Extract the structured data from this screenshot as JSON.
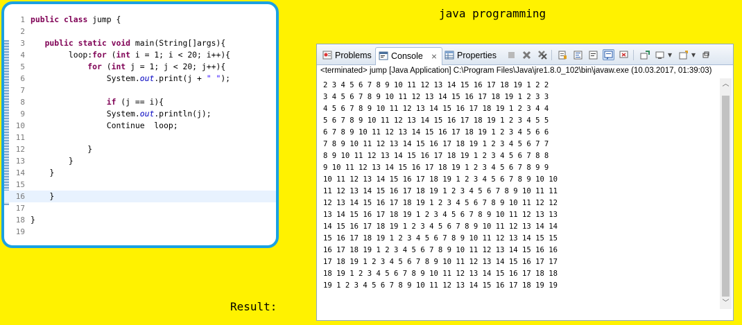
{
  "page": {
    "heading": "java programming",
    "result_label": "Result:"
  },
  "editor": {
    "lines": [
      {
        "n": "1",
        "code": "public class jump {"
      },
      {
        "n": "2",
        "code": ""
      },
      {
        "n": "3",
        "code": "   public static void main(String[]args){"
      },
      {
        "n": "4",
        "code": "        loop:for (int i = 1; i < 20; i++){"
      },
      {
        "n": "5",
        "code": "            for (int j = 1; j < 20; j++){"
      },
      {
        "n": "6",
        "code": "                System.out.print(j + \" \");"
      },
      {
        "n": "7",
        "code": ""
      },
      {
        "n": "8",
        "code": "                if (j == i){"
      },
      {
        "n": "9",
        "code": "                System.out.println(j);"
      },
      {
        "n": "10",
        "code": "                Continue  loop;"
      },
      {
        "n": "11",
        "code": ""
      },
      {
        "n": "12",
        "code": "            }"
      },
      {
        "n": "13",
        "code": "        }"
      },
      {
        "n": "14",
        "code": "    }"
      },
      {
        "n": "15",
        "code": ""
      },
      {
        "n": "16",
        "code": "    }"
      },
      {
        "n": "17",
        "code": ""
      },
      {
        "n": "18",
        "code": "}"
      },
      {
        "n": "19",
        "code": ""
      }
    ]
  },
  "console": {
    "tabs": [
      {
        "label": "Problems",
        "icon": "problems-icon"
      },
      {
        "label": "Console",
        "icon": "console-icon",
        "active": true
      },
      {
        "label": "Properties",
        "icon": "properties-icon"
      }
    ],
    "close_symbol": "⨯",
    "status": "<terminated> jump [Java Application] C:\\Program Files\\Java\\jre1.8.0_102\\bin\\javaw.exe (10.03.2017, 01:39:03)",
    "output": [
      "2 3 4 5 6 7 8 9 10 11 12 13 14 15 16 17 18 19 1 2 2",
      "3 4 5 6 7 8 9 10 11 12 13 14 15 16 17 18 19 1 2 3 3",
      "4 5 6 7 8 9 10 11 12 13 14 15 16 17 18 19 1 2 3 4 4",
      "5 6 7 8 9 10 11 12 13 14 15 16 17 18 19 1 2 3 4 5 5",
      "6 7 8 9 10 11 12 13 14 15 16 17 18 19 1 2 3 4 5 6 6",
      "7 8 9 10 11 12 13 14 15 16 17 18 19 1 2 3 4 5 6 7 7",
      "8 9 10 11 12 13 14 15 16 17 18 19 1 2 3 4 5 6 7 8 8",
      "9 10 11 12 13 14 15 16 17 18 19 1 2 3 4 5 6 7 8 9 9",
      "10 11 12 13 14 15 16 17 18 19 1 2 3 4 5 6 7 8 9 10 10",
      "11 12 13 14 15 16 17 18 19 1 2 3 4 5 6 7 8 9 10 11 11",
      "12 13 14 15 16 17 18 19 1 2 3 4 5 6 7 8 9 10 11 12 12",
      "13 14 15 16 17 18 19 1 2 3 4 5 6 7 8 9 10 11 12 13 13",
      "14 15 16 17 18 19 1 2 3 4 5 6 7 8 9 10 11 12 13 14 14",
      "15 16 17 18 19 1 2 3 4 5 6 7 8 9 10 11 12 13 14 15 15",
      "16 17 18 19 1 2 3 4 5 6 7 8 9 10 11 12 13 14 15 16 16",
      "17 18 19 1 2 3 4 5 6 7 8 9 10 11 12 13 14 15 16 17 17",
      "18 19 1 2 3 4 5 6 7 8 9 10 11 12 13 14 15 16 17 18 18",
      "19 1 2 3 4 5 6 7 8 9 10 11 12 13 14 15 16 17 18 19 19"
    ],
    "toolbar_icons": [
      "terminate-icon",
      "remove-launch-icon",
      "remove-all-icon",
      "scroll-lock-icon",
      "word-wrap-icon",
      "show-on-output-icon",
      "show-on-error-icon",
      "pin-console-icon",
      "display-console-icon",
      "open-console-icon",
      "minimize-icon"
    ]
  },
  "colors": {
    "background": "#fff200",
    "editor_border": "#1ba1e2",
    "keyword": "#7f0055",
    "field": "#0000c0",
    "string": "#2a00ff"
  }
}
